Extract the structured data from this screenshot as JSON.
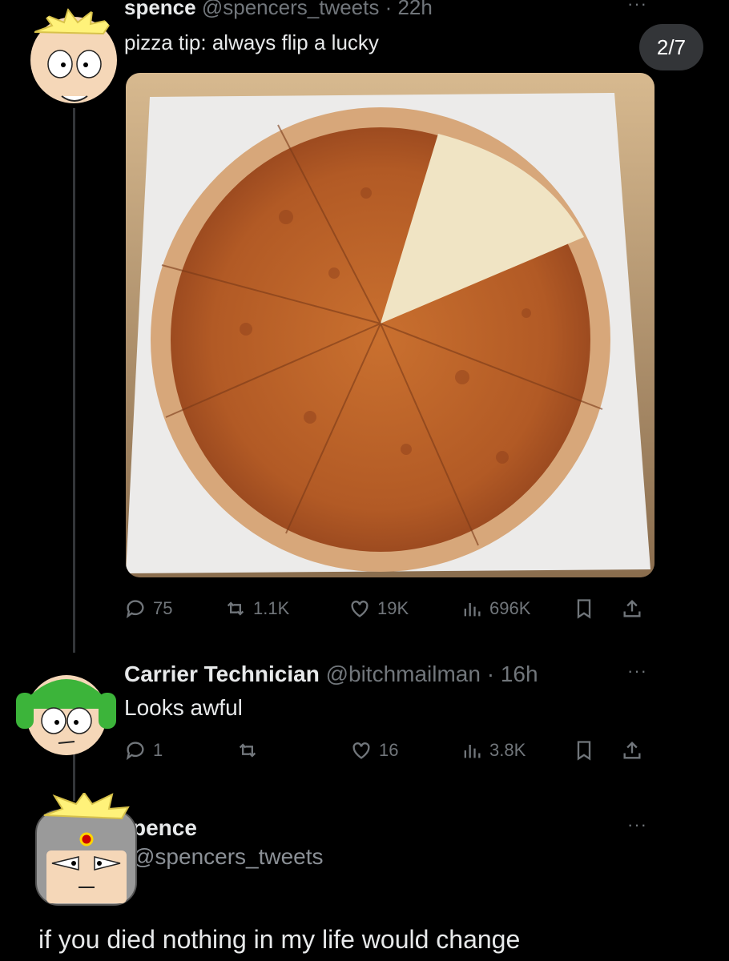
{
  "page": {
    "counter": "2/7",
    "more_icon": "···"
  },
  "tweet1": {
    "author_name": "spence",
    "author_handle": "@spencers_tweets",
    "time": "· 22h",
    "text": "pizza tip: always flip a lucky",
    "image_icon": "pizza-photo",
    "metrics": {
      "replies": "75",
      "reposts": "1.1K",
      "likes": "19K",
      "views": "696K"
    }
  },
  "tweet2": {
    "author_name": "Carrier Technician",
    "author_handle": "@bitchmailman",
    "time": "· 16h",
    "text": "Looks awful",
    "metrics": {
      "replies": "1",
      "likes": "16",
      "views": "3.8K"
    }
  },
  "tweet3": {
    "author_name": "pence",
    "author_handle": "@spencers_tweets",
    "text": "if you died nothing in my life would change"
  },
  "colors": {
    "background": "#000000",
    "text": "#e7e9ea",
    "muted": "#71767b"
  }
}
